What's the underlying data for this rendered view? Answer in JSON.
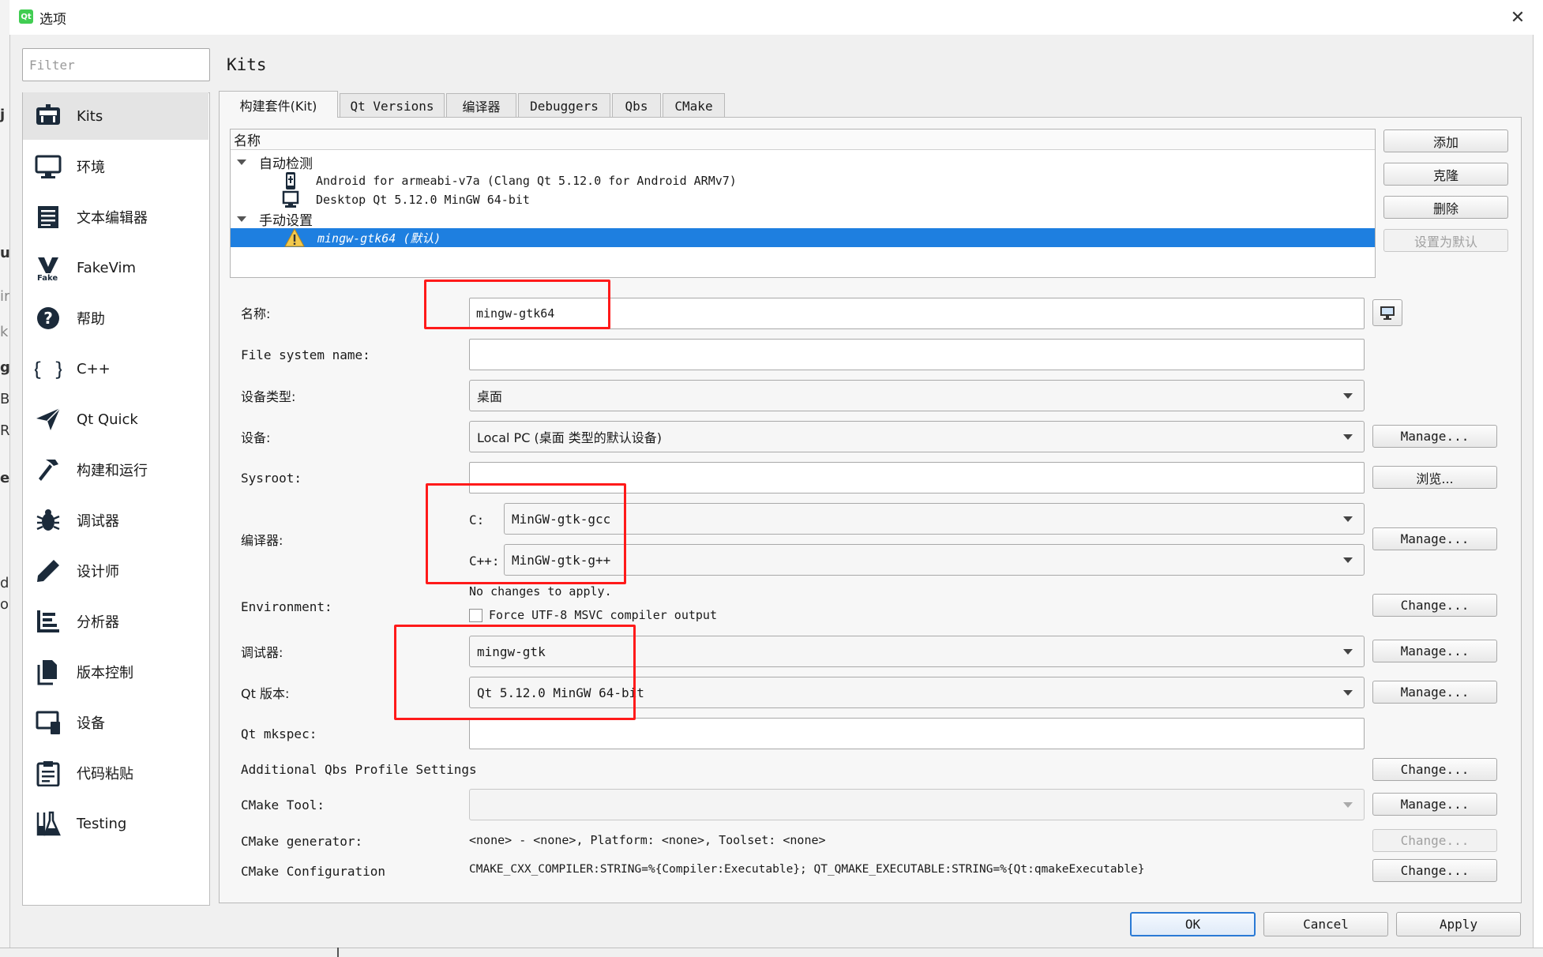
{
  "window": {
    "title": "选项",
    "app_icon": "qt-logo-icon",
    "close_glyph": "✕"
  },
  "filter": {
    "placeholder": "Filter"
  },
  "sidebar": {
    "items": [
      {
        "label": "Kits",
        "icon": "kits-icon"
      },
      {
        "label": "环境",
        "icon": "monitor-icon"
      },
      {
        "label": "文本编辑器",
        "icon": "text-editor-icon"
      },
      {
        "label": "FakeVim",
        "icon": "fakevim-icon"
      },
      {
        "label": "帮助",
        "icon": "help-icon"
      },
      {
        "label": "C++",
        "icon": "braces-icon"
      },
      {
        "label": "Qt Quick",
        "icon": "paper-plane-icon"
      },
      {
        "label": "构建和运行",
        "icon": "hammer-icon"
      },
      {
        "label": "调试器",
        "icon": "bug-icon"
      },
      {
        "label": "设计师",
        "icon": "pencil-icon"
      },
      {
        "label": "分析器",
        "icon": "analyzer-icon"
      },
      {
        "label": "版本控制",
        "icon": "version-control-icon"
      },
      {
        "label": "设备",
        "icon": "device-icon"
      },
      {
        "label": "代码粘贴",
        "icon": "clipboard-icon"
      },
      {
        "label": "Testing",
        "icon": "flask-icon"
      }
    ],
    "selected": "Kits"
  },
  "behind_window_fragments": [
    "j",
    "u",
    "ir",
    "k",
    "g",
    "B",
    "R",
    "et",
    "d",
    "o"
  ],
  "page": {
    "title": "Kits"
  },
  "tabs": [
    "构建套件(Kit)",
    "Qt Versions",
    "编译器",
    "Debuggers",
    "Qbs",
    "CMake"
  ],
  "tree": {
    "header": "名称",
    "groups": [
      {
        "label": "自动检测",
        "items": [
          "Android for armeabi-v7a (Clang Qt 5.12.0 for Android ARMv7)",
          "Desktop Qt 5.12.0 MinGW 64-bit"
        ]
      },
      {
        "label": "手动设置",
        "items": [
          "mingw-gtk64 (默认)"
        ]
      }
    ]
  },
  "right_buttons": {
    "add": "添加",
    "clone": "克隆",
    "remove": "删除",
    "make_default": "设置为默认"
  },
  "form": {
    "name_label": "名称:",
    "name_value": "mingw-gtk64",
    "fs_name_label": "File system name:",
    "fs_name_value": "",
    "device_type_label": "设备类型:",
    "device_type_value": "桌面",
    "device_label": "设备:",
    "device_value": "Local PC (桌面 类型的默认设备)",
    "sysroot_label": "Sysroot:",
    "sysroot_value": "",
    "compiler_label": "编译器:",
    "c_label": "C:",
    "c_value": "MinGW-gtk-gcc",
    "cpp_label": "C++:",
    "cpp_value": "MinGW-gtk-g++",
    "environment_label": "Environment:",
    "environment_text": "No changes to apply.",
    "force_utf8_label": "Force UTF-8 MSVC compiler output",
    "debugger_label": "调试器:",
    "debugger_value": "mingw-gtk",
    "qt_version_label": "Qt 版本:",
    "qt_version_value": "Qt 5.12.0 MinGW 64-bit",
    "mkspec_label": "Qt mkspec:",
    "mkspec_value": "",
    "qbs_label": "Additional Qbs Profile Settings",
    "cmake_tool_label": "CMake Tool:",
    "cmake_tool_value": "",
    "cmake_generator_label": "CMake generator:",
    "cmake_generator_value": "<none> - <none>, Platform: <none>, Toolset: <none>",
    "cmake_config_label": "CMake Configuration",
    "cmake_config_value": "CMAKE_CXX_COMPILER:STRING=%{Compiler:Executable}; QT_QMAKE_EXECUTABLE:STRING=%{Qt:qmakeExecutable}"
  },
  "side_buttons": {
    "manage": "Manage...",
    "browse": "浏览...",
    "change": "Change..."
  },
  "footer": {
    "ok": "OK",
    "cancel": "Cancel",
    "apply": "Apply"
  },
  "colors": {
    "selection": "#1e7fe0",
    "annotation": "#ff1a1a",
    "dialog_bg": "#f0f0f0"
  }
}
